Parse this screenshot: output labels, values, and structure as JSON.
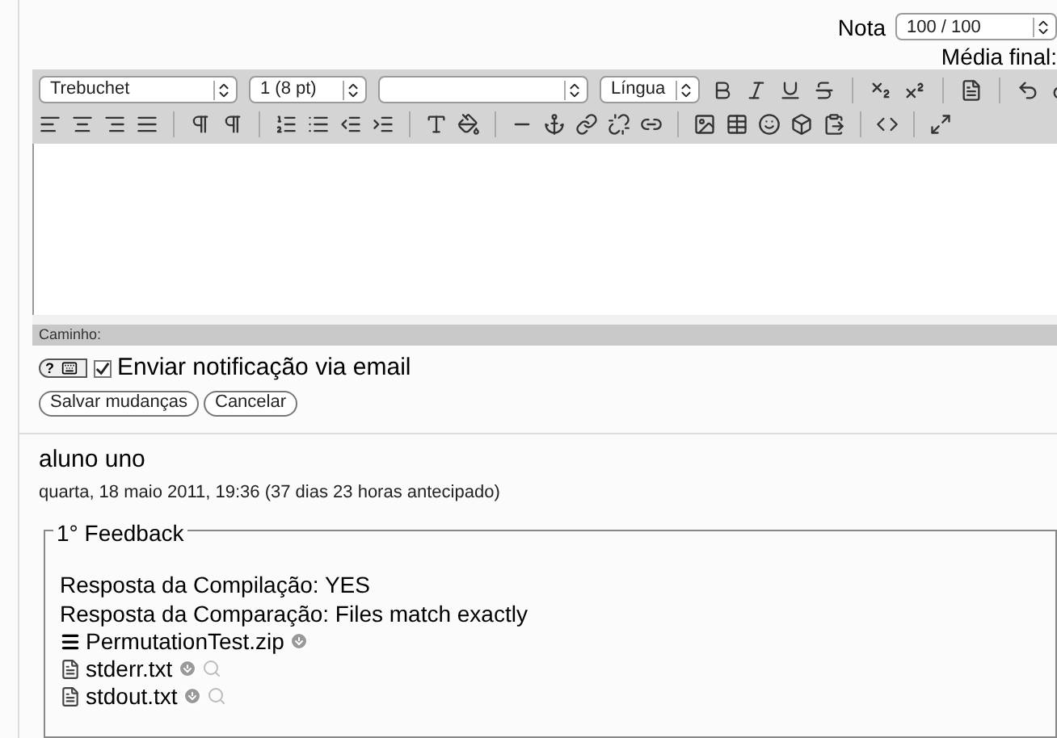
{
  "grade": {
    "label": "Nota",
    "value": "100 / 100",
    "final_label": "Média final:"
  },
  "editor": {
    "font": "Trebuchet",
    "size": "1 (8 pt)",
    "language": "Língua",
    "path_label": "Caminho:"
  },
  "help_button": {
    "label": "?"
  },
  "notify": {
    "label": "Enviar notificação via email",
    "checked": true
  },
  "buttons": [
    "Salvar mudanças",
    "Cancelar"
  ],
  "submission": {
    "author": "aluno uno",
    "date": "quarta, 18 maio 2011, 19:36 (37 dias 23 horas antecipado)"
  },
  "feedback": {
    "legend": "1° Feedback",
    "lines": [
      "Resposta da Compilação: YES",
      "Resposta da Comparação: Files match exactly"
    ],
    "files": [
      {
        "name": "PermutationTest.zip",
        "kind": "archive",
        "preview": false
      },
      {
        "name": "stderr.txt",
        "kind": "text",
        "preview": true
      },
      {
        "name": "stdout.txt",
        "kind": "text",
        "preview": true
      }
    ]
  }
}
